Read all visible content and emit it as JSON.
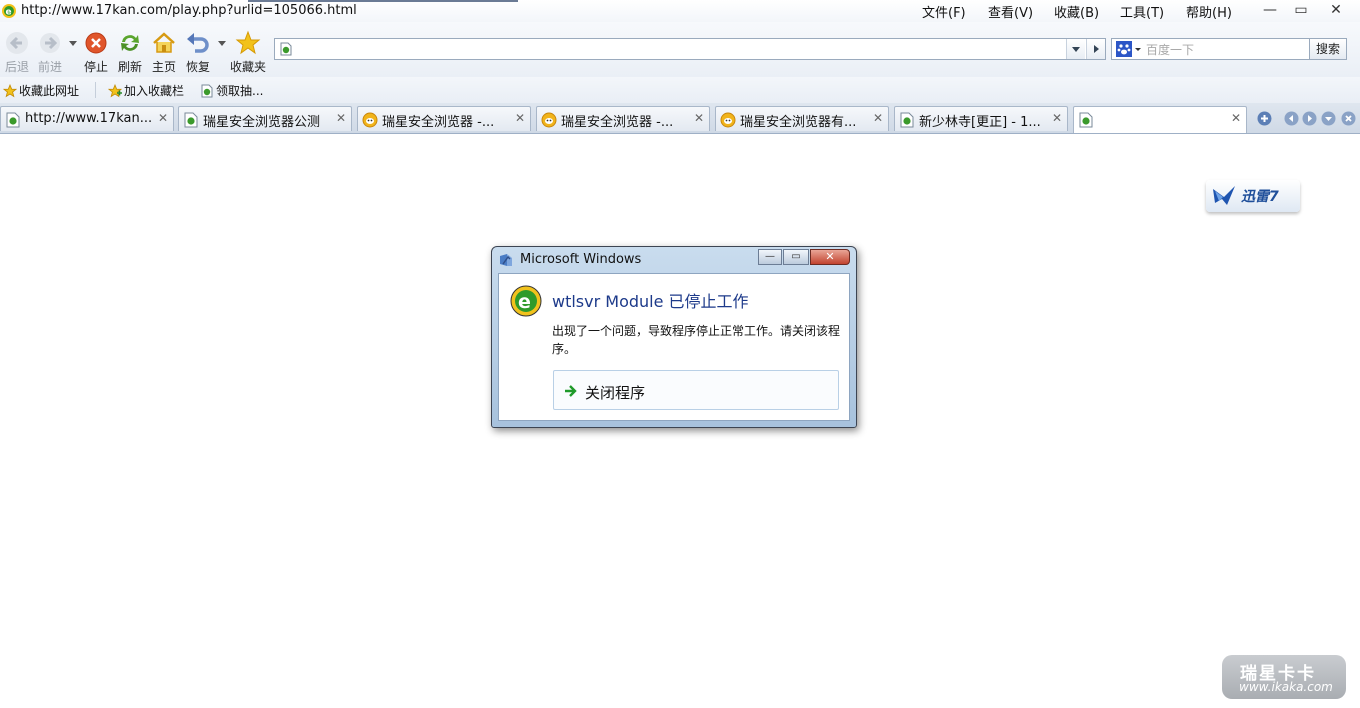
{
  "window": {
    "title_url": "http://www.17kan.com/play.php?urlid=105066.html",
    "menu": [
      {
        "label": "文件(F)"
      },
      {
        "label": "查看(V)"
      },
      {
        "label": "收藏(B)"
      },
      {
        "label": "工具(T)"
      },
      {
        "label": "帮助(H)"
      }
    ],
    "controls": {
      "minimize": "—",
      "restore": "▭",
      "close": "✕"
    }
  },
  "toolbar": {
    "back_label": "后退",
    "forward_label": "前进",
    "stop_label": "停止",
    "refresh_label": "刷新",
    "home_label": "主页",
    "restore_label": "恢复",
    "favorites_label": "收藏夹",
    "address_value": "",
    "search_placeholder": "百度一下",
    "search_button": "搜索",
    "colors": {
      "stop": "#e0552b",
      "refresh": "#5aa52e",
      "home": "#e8b92a",
      "restore": "#6e8fc9",
      "star": "#f2c21b"
    }
  },
  "favorites_bar": {
    "items": [
      {
        "label": "收藏此网址"
      },
      {
        "label": "加入收藏栏"
      },
      {
        "label": "领取抽..."
      }
    ]
  },
  "tabs": [
    {
      "title": "http://www.17kan....",
      "icon": "page-icon"
    },
    {
      "title": "瑞星安全浏览器公测",
      "icon": "page-icon"
    },
    {
      "title": "瑞星安全浏览器 -...",
      "icon": "rising-icon"
    },
    {
      "title": "瑞星安全浏览器 -...",
      "icon": "rising-icon"
    },
    {
      "title": "瑞星安全浏览器有...",
      "icon": "rising-icon"
    },
    {
      "title": "新少林寺[更正] - 1...",
      "icon": "page-icon"
    },
    {
      "title": "",
      "icon": "page-icon",
      "active": true
    }
  ],
  "content": {
    "xunlei_label": "迅雷7",
    "watermark_title": "瑞星卡卡",
    "watermark_url": "www.ikaka.com"
  },
  "dialog": {
    "title": "Microsoft Windows",
    "heading": "wtlsvr Module 已停止工作",
    "message": "出现了一个问题，导致程序停止正常工作。请关闭该程序。",
    "action_label": "关闭程序",
    "close_glyph": "✕"
  }
}
